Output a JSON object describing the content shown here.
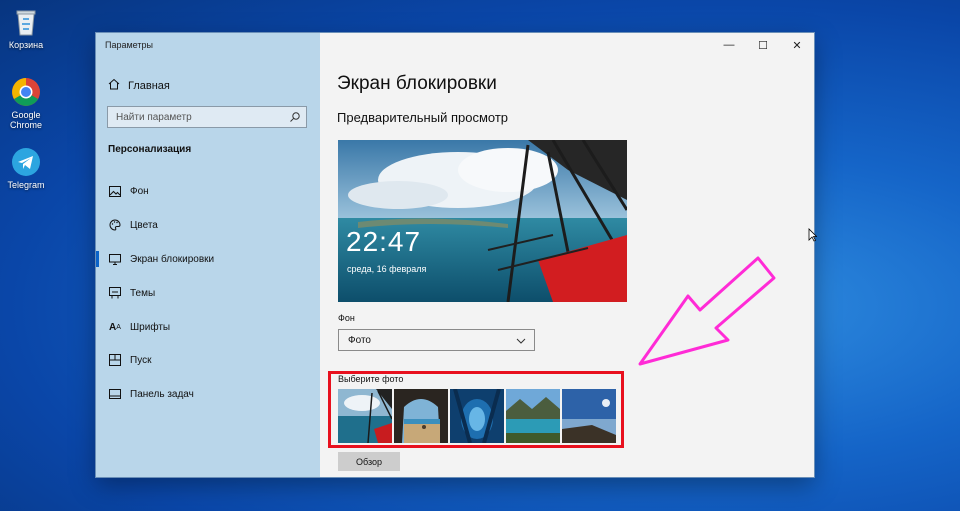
{
  "desktop": {
    "icons": [
      {
        "label": "Корзина",
        "icon": "recycle-bin-icon"
      },
      {
        "label": "Google Chrome",
        "icon": "chrome-icon"
      },
      {
        "label": "Telegram",
        "icon": "telegram-icon"
      }
    ]
  },
  "window": {
    "title": "Параметры",
    "controls": {
      "minimize": "—",
      "maximize": "☐",
      "close": "✕"
    }
  },
  "sidebar": {
    "home": "Главная",
    "search_placeholder": "Найти параметр",
    "section": "Персонализация",
    "items": [
      {
        "label": "Фон",
        "icon": "image-icon"
      },
      {
        "label": "Цвета",
        "icon": "palette-icon"
      },
      {
        "label": "Экран блокировки",
        "icon": "monitor-icon",
        "active": true
      },
      {
        "label": "Темы",
        "icon": "brush-icon"
      },
      {
        "label": "Шрифты",
        "icon": "font-icon"
      },
      {
        "label": "Пуск",
        "icon": "start-icon"
      },
      {
        "label": "Панель задач",
        "icon": "taskbar-icon"
      }
    ]
  },
  "main": {
    "title": "Экран блокировки",
    "preview_heading": "Предварительный просмотр",
    "preview": {
      "time": "22:47",
      "date": "среда, 16 февраля"
    },
    "background_label": "Фон",
    "background_value": "Фото",
    "choose_photo_label": "Выберите фото",
    "browse_button": "Обзор"
  },
  "colors": {
    "accent": "#0a63c9",
    "highlight": "#e8101e",
    "annotation_arrow": "#ff2bd6"
  }
}
